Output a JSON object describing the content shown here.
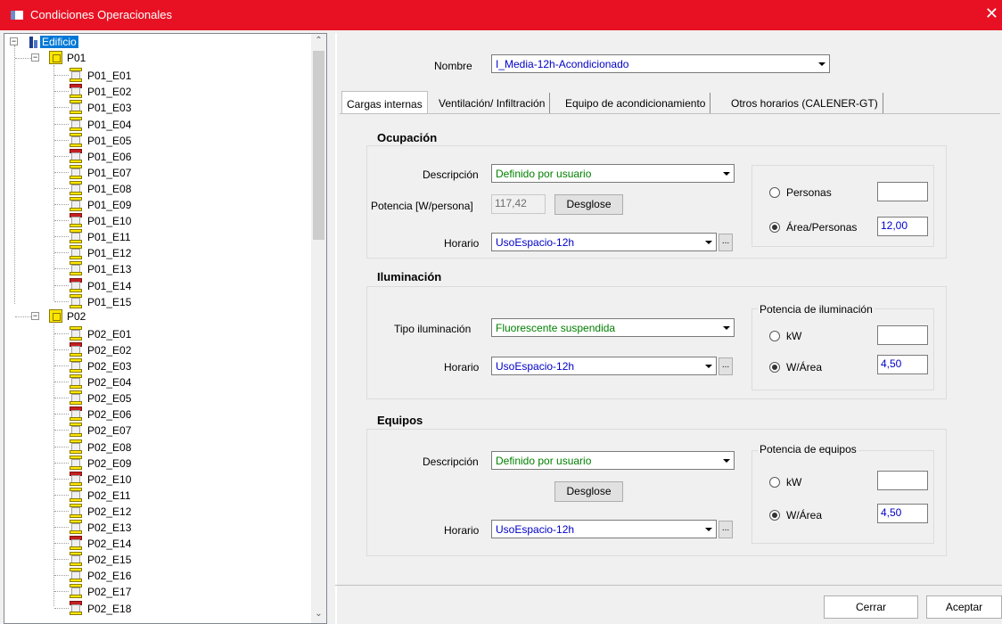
{
  "window": {
    "title": "Condiciones Operacionales",
    "close_glyph": "✕"
  },
  "tree": {
    "root": "Edificio",
    "floors": [
      {
        "name": "P01",
        "spaces": [
          "P01_E01",
          "P01_E02",
          "P01_E03",
          "P01_E04",
          "P01_E05",
          "P01_E06",
          "P01_E07",
          "P01_E08",
          "P01_E09",
          "P01_E10",
          "P01_E11",
          "P01_E12",
          "P01_E13",
          "P01_E14",
          "P01_E15"
        ]
      },
      {
        "name": "P02",
        "spaces": [
          "P02_E01",
          "P02_E02",
          "P02_E03",
          "P02_E04",
          "P02_E05",
          "P02_E06",
          "P02_E07",
          "P02_E08",
          "P02_E09",
          "P02_E10",
          "P02_E11",
          "P02_E12",
          "P02_E13",
          "P02_E14",
          "P02_E15",
          "P02_E16",
          "P02_E17",
          "P02_E18"
        ]
      }
    ]
  },
  "header": {
    "nombre_label": "Nombre",
    "nombre_value": "I_Media-12h-Acondicionado"
  },
  "tabs": [
    "Cargas internas",
    "Ventilación/ Infiltración",
    "Equipo de acondicionamiento",
    "Otros horarios (CALENER-GT)"
  ],
  "ocupacion": {
    "title": "Ocupación",
    "descripcion_label": "Descripción",
    "descripcion_value": "Definido por usuario",
    "potencia_label": "Potencia [W/persona]",
    "potencia_value": "117,42",
    "desglose_label": "Desglose",
    "horario_label": "Horario",
    "horario_value": "UsoEspacio-12h",
    "more_label": "...",
    "personas_label": "Personas",
    "personas_value": "",
    "area_personas_label": "Área/Personas",
    "area_personas_value": "12,00"
  },
  "iluminacion": {
    "title": "Iluminación",
    "tipo_label": "Tipo iluminación",
    "tipo_value": "Fluorescente suspendida",
    "horario_label": "Horario",
    "horario_value": "UsoEspacio-12h",
    "more_label": "...",
    "group_label": "Potencia de iluminación",
    "kw_label": "kW",
    "kw_value": "",
    "warea_label": "W/Área",
    "warea_value": "4,50"
  },
  "equipos": {
    "title": "Equipos",
    "descripcion_label": "Descripción",
    "descripcion_value": "Definido por usuario",
    "desglose_label": "Desglose",
    "horario_label": "Horario",
    "horario_value": "UsoEspacio-12h",
    "more_label": "...",
    "group_label": "Potencia de equipos",
    "kw_label": "kW",
    "kw_value": "",
    "warea_label": "W/Área",
    "warea_value": "4,50"
  },
  "footer": {
    "cerrar": "Cerrar",
    "aceptar": "Aceptar"
  }
}
